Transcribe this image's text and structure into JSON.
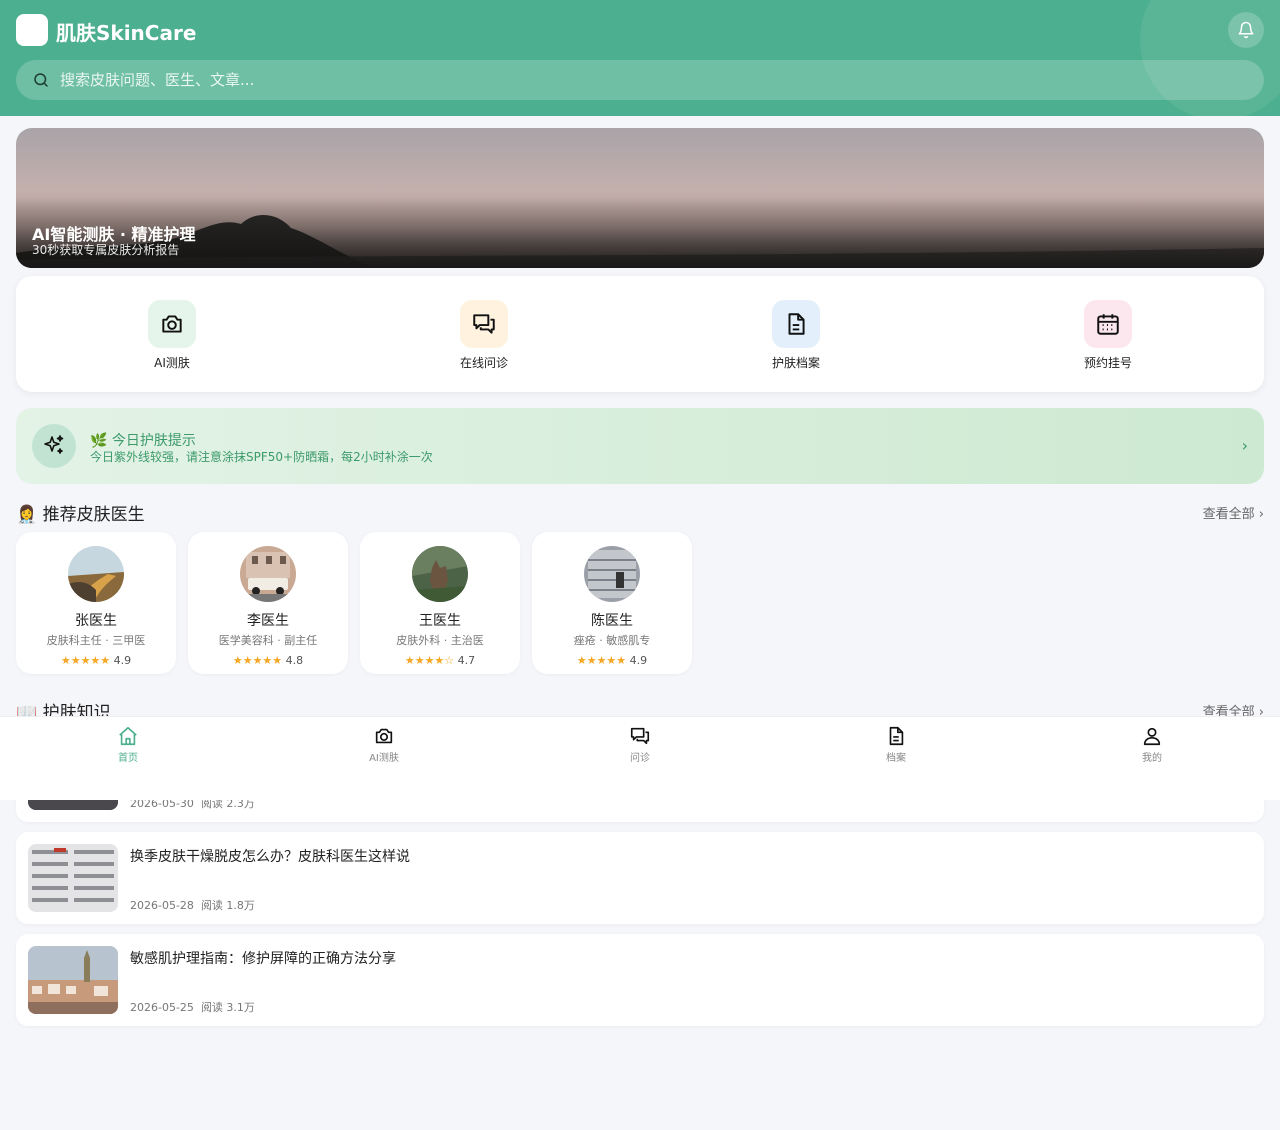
{
  "header": {
    "logo_glyph": "",
    "title": "肌肤SkinCare",
    "search_placeholder": "搜索皮肤问题、医生、文章..."
  },
  "banner": {
    "title": "AI智能测肤 · 精准护理",
    "subtitle": "30秒获取专属皮肤分析报告"
  },
  "quick_actions": [
    {
      "label": "AI测肤",
      "icon": "camera-icon",
      "bg": "#e6f5ec"
    },
    {
      "label": "在线问诊",
      "icon": "chat-icon",
      "bg": "#fff3e0"
    },
    {
      "label": "护肤档案",
      "icon": "document-icon",
      "bg": "#e3f0fc"
    },
    {
      "label": "预约挂号",
      "icon": "calendar-icon",
      "bg": "#fde7ee"
    }
  ],
  "tip": {
    "title": "🌿 今日护肤提示",
    "text": "今日紫外线较强，请注意涂抹SPF50+防晒霜，每2小时补涂一次",
    "arrow": "›"
  },
  "doctors_section": {
    "title": "👩‍⚕️ 推荐皮肤医生",
    "more": "查看全部 ›",
    "items": [
      {
        "name": "张医生",
        "dept": "皮肤科主任 · 三甲医",
        "stars": "★★★★★",
        "rating": "4.9"
      },
      {
        "name": "李医生",
        "dept": "医学美容科 · 副主任",
        "stars": "★★★★★",
        "rating": "4.8"
      },
      {
        "name": "王医生",
        "dept": "皮肤外科 · 主治医",
        "stars": "★★★★☆",
        "rating": "4.7"
      },
      {
        "name": "陈医生",
        "dept": "痤疮 · 敏感肌专",
        "stars": "★★★★★",
        "rating": "4.9"
      }
    ]
  },
  "articles_section": {
    "title": "📖 护肤知识",
    "more": "查看全部 ›",
    "items": [
      {
        "title": "",
        "date": "2026-05-30",
        "views": "阅读 2.3万"
      },
      {
        "title": "换季皮肤干燥脱皮怎么办？皮肤科医生这样说",
        "date": "2026-05-28",
        "views": "阅读 1.8万"
      },
      {
        "title": "敏感肌护理指南：修护屏障的正确方法分享",
        "date": "2026-05-25",
        "views": "阅读 3.1万"
      }
    ]
  },
  "bottom_nav": [
    {
      "label": "首页",
      "icon": "home-icon",
      "active": true
    },
    {
      "label": "AI测肤",
      "icon": "camera-icon",
      "active": false
    },
    {
      "label": "问诊",
      "icon": "chat-icon",
      "active": false
    },
    {
      "label": "档案",
      "icon": "document-icon",
      "active": false
    },
    {
      "label": "我的",
      "icon": "user-icon",
      "active": false
    }
  ],
  "colors": {
    "primary": "#4caf8f",
    "star": "#f5a623",
    "tip_text": "#3c9a6b"
  }
}
